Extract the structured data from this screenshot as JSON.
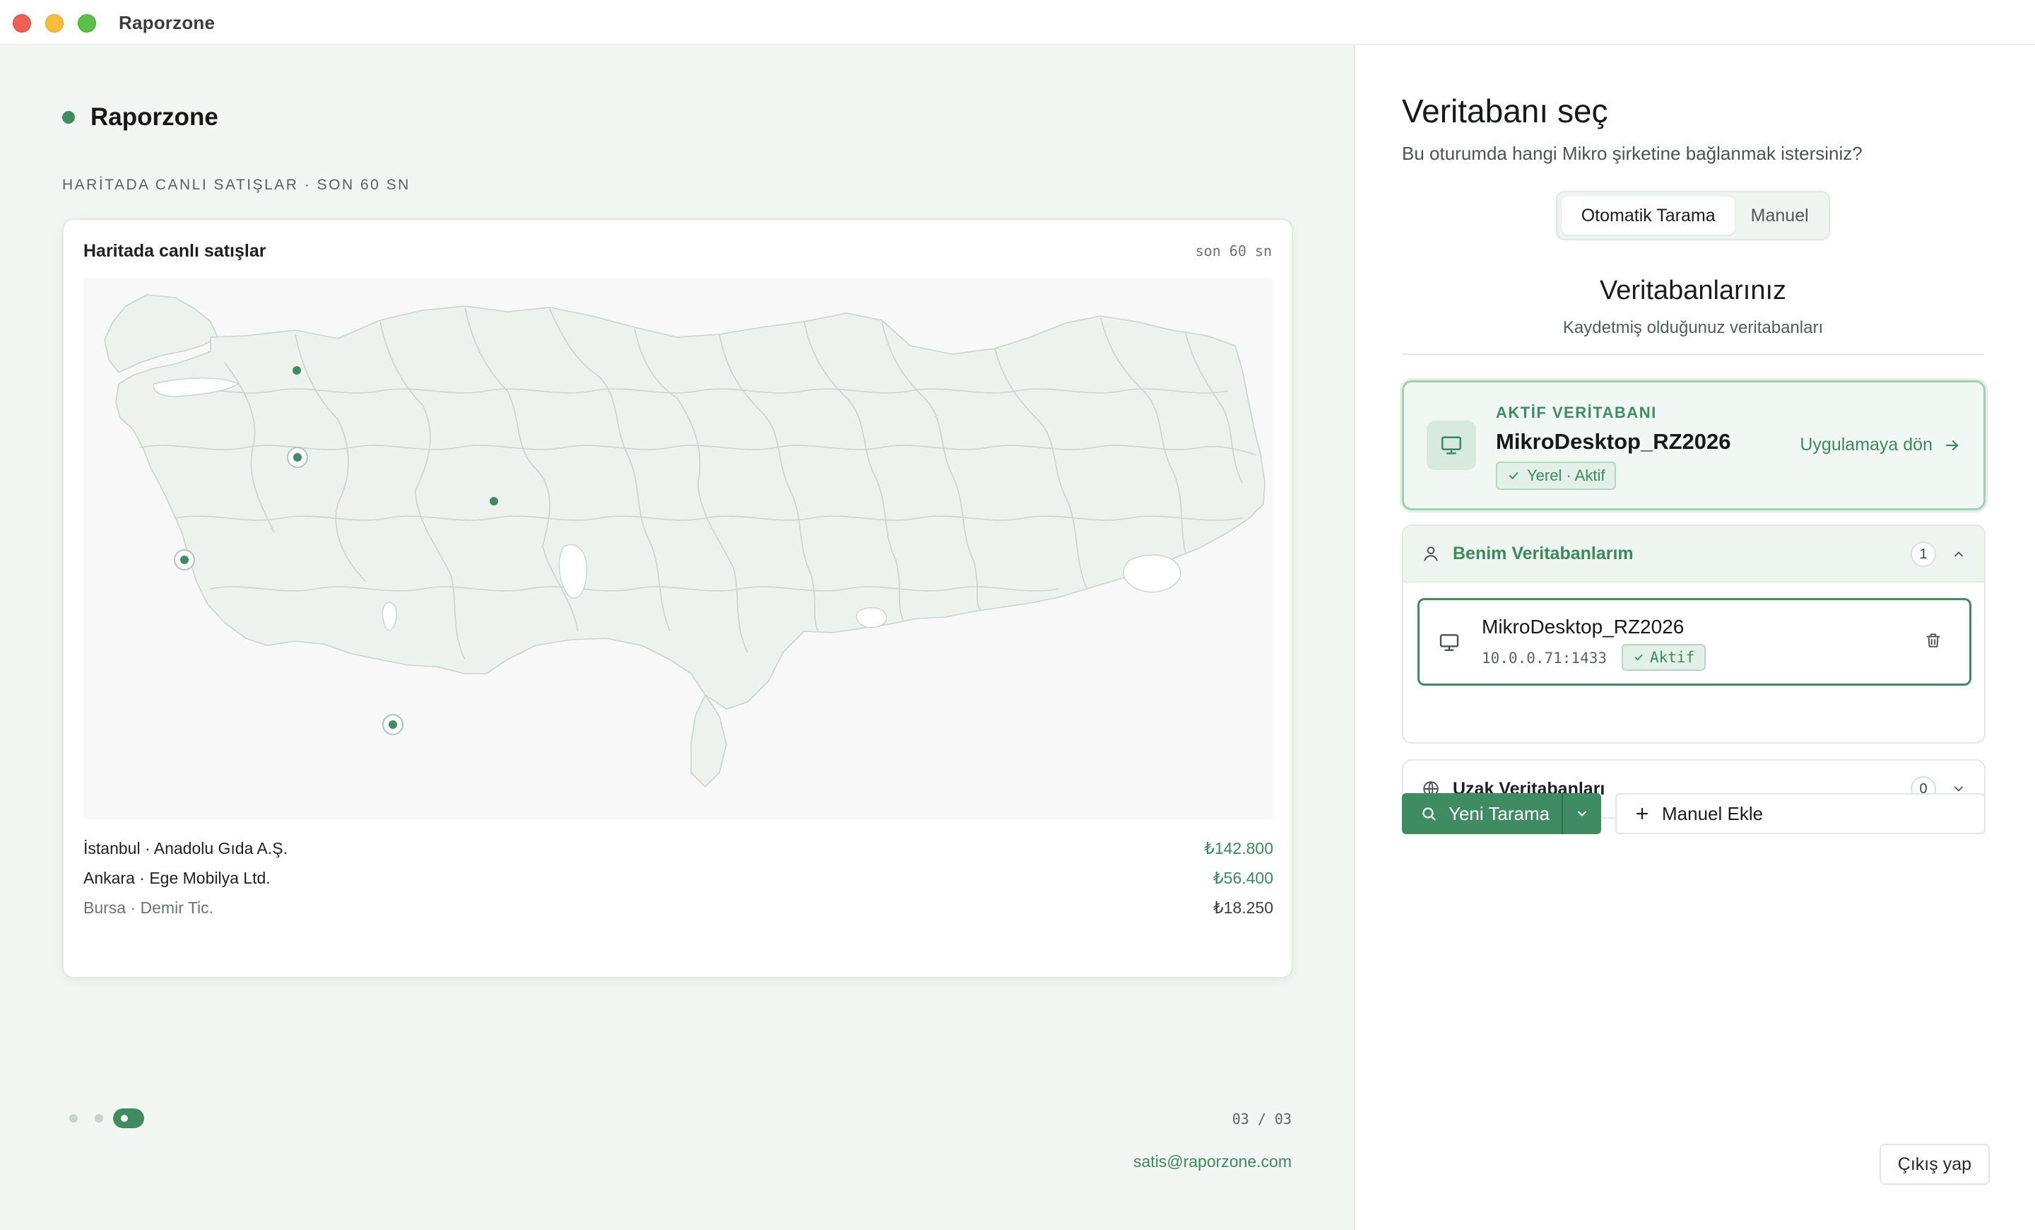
{
  "window": {
    "title": "Raporzone"
  },
  "left": {
    "brand_name": "Raporzone",
    "section_label": "HARİTADA CANLI SATIŞLAR · SON 60 SN",
    "card": {
      "title": "Haritada canlı satışlar",
      "meta": "son 60 sn"
    },
    "map_pins": [
      {
        "name": "pin-istanbul",
        "style": "plain"
      },
      {
        "name": "pin-bursa",
        "style": "ring"
      },
      {
        "name": "pin-ankara",
        "style": "plain"
      },
      {
        "name": "pin-izmir",
        "style": "ring"
      },
      {
        "name": "pin-antalya",
        "style": "ring"
      }
    ],
    "sales": [
      {
        "name": "İstanbul · Anadolu Gıda A.Ş.",
        "amount": "₺142.800"
      },
      {
        "name": "Ankara · Ege Mobilya Ltd.",
        "amount": "₺56.400"
      },
      {
        "name": "Bursa · Demir Tic.",
        "amount": "₺18.250"
      }
    ],
    "pager": {
      "count_text": "03 / 03"
    },
    "contact_email": "satis@raporzone.com"
  },
  "right": {
    "title": "Veritabanı seç",
    "subtitle": "Bu oturumda hangi Mikro şirketine bağlanmak istersiniz?",
    "tabs": {
      "auto_label": "Otomatik Tarama",
      "manual_label": "Manuel"
    },
    "db_heading": "Veritabanlarınız",
    "db_subheading": "Kaydetmiş olduğunuz veritabanları",
    "active": {
      "label": "AKTİF VERİTABANI",
      "name": "MikroDesktop_RZ2026",
      "badge": "Yerel · Aktif",
      "return_label": "Uygulamaya dön"
    },
    "my_databases": {
      "title": "Benim Veritabanlarım",
      "count": "1",
      "items": [
        {
          "name": "MikroDesktop_RZ2026",
          "host": "10.0.0.71:1433",
          "status": "Aktif"
        }
      ]
    },
    "remote_databases": {
      "title": "Uzak Veritabanları",
      "count": "0"
    },
    "actions": {
      "scan_label": "Yeni Tarama",
      "manual_add_label": "Manuel Ekle"
    },
    "logout_label": "Çıkış yap"
  },
  "colors": {
    "accent": "#3f8c63",
    "accent_text": "#3a8a5e",
    "panel_bg": "#f1f6f3",
    "map_fill": "#edf2ef",
    "map_stroke": "#c9d4ce"
  },
  "icons": {
    "active_db": "monitor-icon",
    "return": "arrow-right-icon",
    "group_mine": "user-icon",
    "group_remote": "globe-icon",
    "delete": "trash-icon",
    "scan": "search-icon",
    "add": "plus-icon"
  }
}
